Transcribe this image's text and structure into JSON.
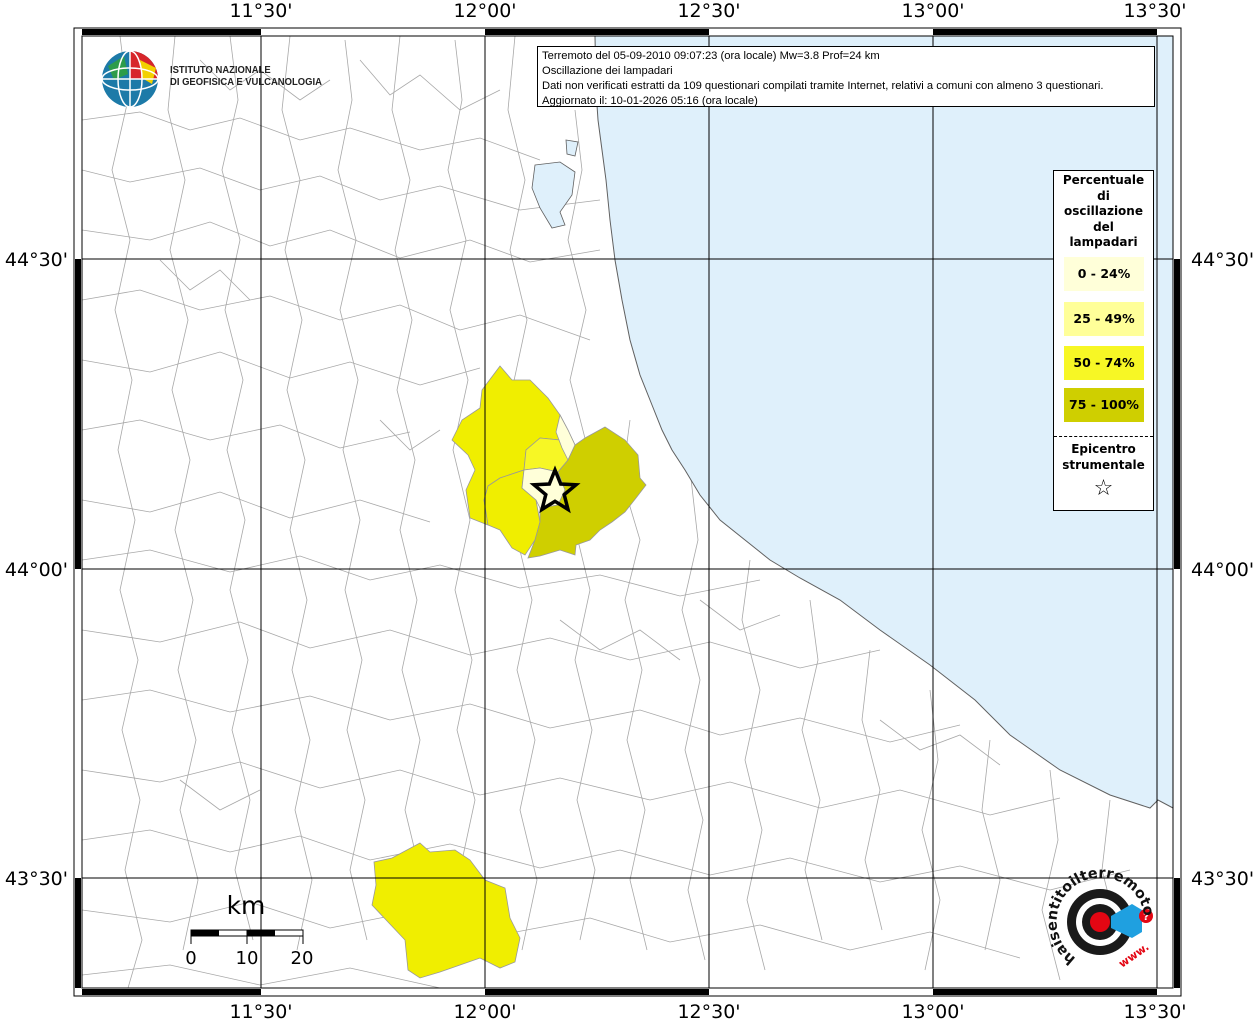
{
  "info_box": {
    "line1": "Terremoto del 05-09-2010 09:07:23 (ora locale) Mw=3.8 Prof=24 km",
    "line2": "Oscillazione dei lampadari",
    "line3": "Dati non verificati estratti da 109 questionari compilati tramite Internet, relativi a comuni con almeno 3 questionari.",
    "line4": "Aggiornato il: 10-01-2026 05:16 (ora locale)"
  },
  "legend": {
    "title_lines": [
      "Percentuale",
      "di",
      "oscillazione",
      "del",
      "lampadari"
    ],
    "items": [
      {
        "label": "0 - 24%",
        "color": "#ffffd9"
      },
      {
        "label": "25 - 49%",
        "color": "#ffff99"
      },
      {
        "label": "50 - 74%",
        "color": "#f7f725"
      },
      {
        "label": "75 - 100%",
        "color": "#cfcf00"
      }
    ],
    "epicenter_lines": [
      "Epicentro",
      "strumentale"
    ],
    "epicenter_symbol": "☆"
  },
  "axes": {
    "top_labels": [
      "11°30'",
      "12°00'",
      "12°30'",
      "13°00'",
      "13°30'"
    ],
    "bottom_labels": [
      "11°30'",
      "12°00'",
      "12°30'",
      "13°00'",
      "13°30'"
    ],
    "left_labels": [
      "44°30'",
      "44°00'",
      "43°30'"
    ],
    "right_labels": [
      "44°30'",
      "44°00'",
      "43°30'"
    ]
  },
  "scale_bar": {
    "unit": "km",
    "tick_labels": [
      "0",
      "10",
      "20"
    ]
  },
  "logos": {
    "ingv_line1": "ISTITUTO NAZIONALE",
    "ingv_line2": "DI GEOFISICA E VULCANOLOGIA",
    "hsit_text_arc": "haisentitoilterremoto.it",
    "hsit_www": "www."
  },
  "colors": {
    "sea": "#dff0fb",
    "land": "#ffffff",
    "borders": "#a0a0a0",
    "grid": "#000000"
  }
}
